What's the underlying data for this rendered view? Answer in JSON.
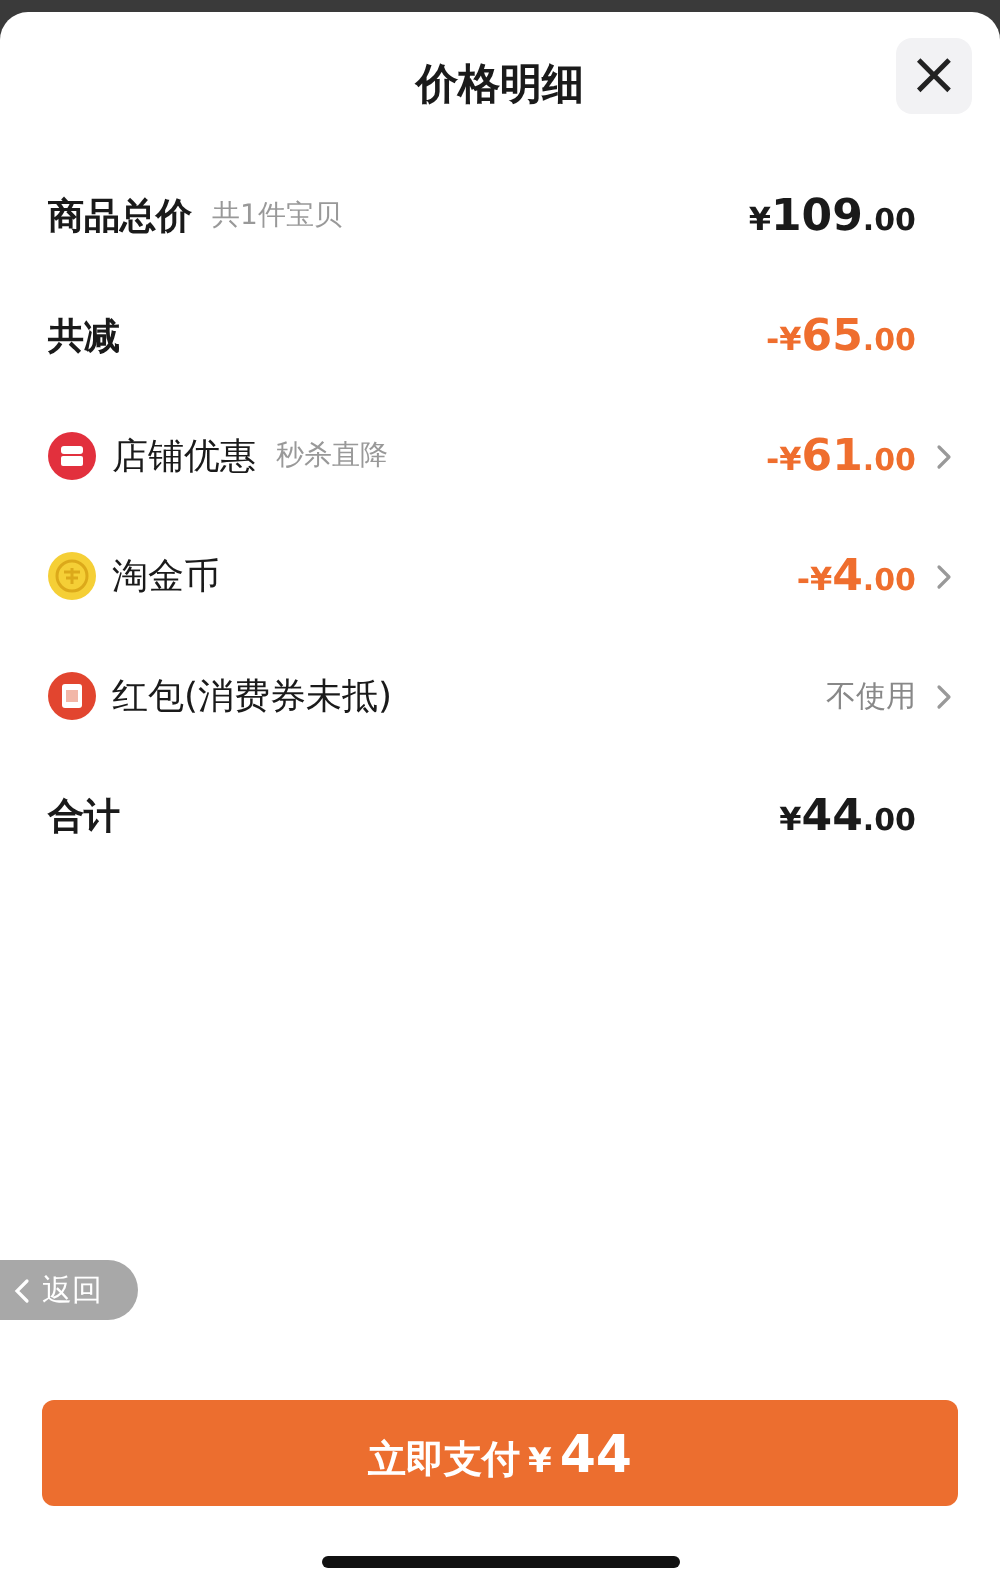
{
  "header": {
    "title": "价格明细",
    "close_button": "×"
  },
  "rows": [
    {
      "kind": "heading",
      "label": "商品总价",
      "note": "共1件宝贝",
      "amount": "¥109.00",
      "discount": false,
      "chevron": false
    },
    {
      "kind": "heading",
      "label": "共减",
      "amount": "-¥65.00",
      "discount": true,
      "chevron": false
    },
    {
      "kind": "shop",
      "label": "店铺优惠",
      "note": "秒杀直降",
      "amount": "-¥61.00",
      "discount": true,
      "chevron": true
    },
    {
      "kind": "coin",
      "label": "淘金币",
      "amount": "-¥4.00",
      "discount": true,
      "chevron": true
    },
    {
      "kind": "envelope",
      "label": "红包(消费券未抵)",
      "value": "不使用",
      "chevron": true
    },
    {
      "kind": "heading",
      "label": "合计",
      "amount": "¥44.00",
      "discount": false,
      "chevron": false
    }
  ],
  "back_button": "返回",
  "pay_button": {
    "label": "立即支付",
    "amount": "¥44"
  }
}
